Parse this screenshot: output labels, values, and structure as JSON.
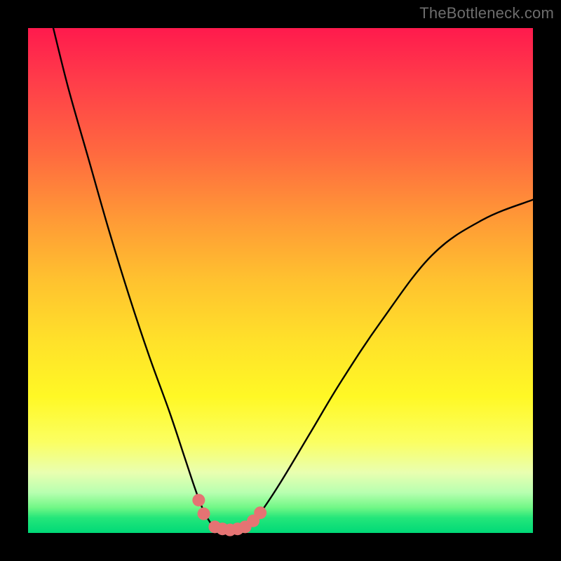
{
  "watermark": {
    "text": "TheBottleneck.com"
  },
  "chart_data": {
    "type": "line",
    "title": "",
    "xlabel": "",
    "ylabel": "",
    "xlim": [
      0,
      100
    ],
    "ylim": [
      0,
      100
    ],
    "grid": false,
    "legend": false,
    "series": [
      {
        "name": "bottleneck-curve",
        "color": "#000000",
        "x": [
          5,
          8,
          12,
          16,
          20,
          24,
          28,
          31,
          33,
          34.5,
          36,
          37,
          38,
          39,
          40,
          41,
          42,
          43,
          44,
          46,
          50,
          56,
          62,
          70,
          80,
          90,
          100
        ],
        "y": [
          100,
          88,
          74,
          60,
          47,
          35,
          24,
          15,
          9,
          5,
          2.2,
          1.2,
          0.8,
          0.6,
          0.5,
          0.6,
          0.8,
          1.2,
          2,
          4,
          10,
          20,
          30,
          42,
          55,
          62,
          66
        ]
      }
    ],
    "markers": {
      "name": "highlight-dots",
      "color": "#e57373",
      "radius_px": 9,
      "points": [
        {
          "x": 33.8,
          "y": 6.5
        },
        {
          "x": 34.8,
          "y": 3.8
        },
        {
          "x": 37.0,
          "y": 1.2
        },
        {
          "x": 38.5,
          "y": 0.8
        },
        {
          "x": 40.0,
          "y": 0.6
        },
        {
          "x": 41.5,
          "y": 0.8
        },
        {
          "x": 43.0,
          "y": 1.2
        },
        {
          "x": 44.6,
          "y": 2.4
        },
        {
          "x": 46.0,
          "y": 4.0
        }
      ]
    }
  }
}
